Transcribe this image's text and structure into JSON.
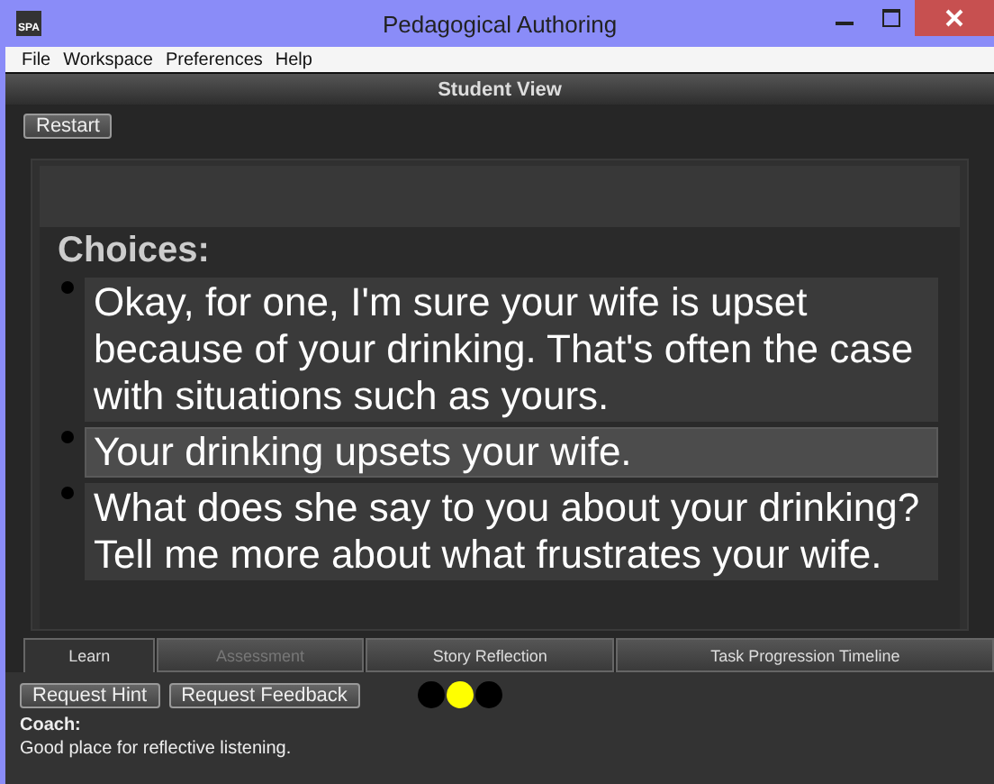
{
  "window": {
    "title": "Pedagogical Authoring",
    "app_icon": "SPA"
  },
  "menu": [
    "File",
    "Workspace",
    "Preferences",
    "Help"
  ],
  "panel_title": "Student View",
  "restart_button": "Restart",
  "choices": {
    "heading": "Choices:",
    "items": [
      {
        "text": "Okay, for one, I'm sure your wife is upset because of your drinking. That's often the case with situations such as yours.",
        "selected": false
      },
      {
        "text": "Your drinking upsets your wife.",
        "selected": true
      },
      {
        "text": "What does she say to you about your drinking? Tell me more about what frustrates your wife.",
        "selected": false
      }
    ]
  },
  "tabs": [
    {
      "label": "Learn",
      "selected": true,
      "disabled": false
    },
    {
      "label": "Assessment",
      "selected": false,
      "disabled": true
    },
    {
      "label": "Story Reflection",
      "selected": false,
      "disabled": false
    },
    {
      "label": "Task Progression Timeline",
      "selected": false,
      "disabled": false
    }
  ],
  "buttons": [
    "Request Hint",
    "Request Feedback"
  ],
  "status_dots": [
    {
      "color": "#000000"
    },
    {
      "color": "#ffff00"
    },
    {
      "color": "#000000"
    }
  ],
  "coach": {
    "label": "Coach:",
    "message": "Good place for reflective listening."
  }
}
